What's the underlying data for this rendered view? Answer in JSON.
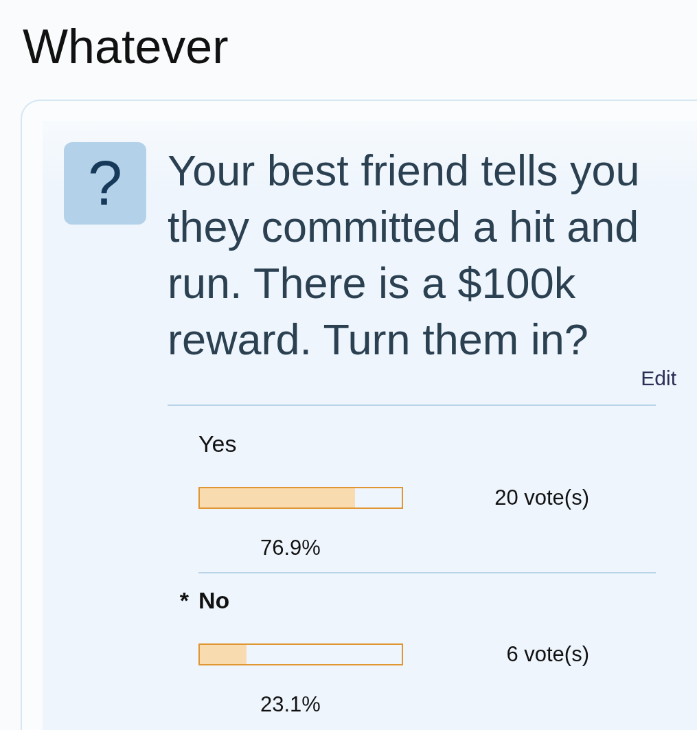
{
  "page": {
    "title": "Whatever"
  },
  "poll": {
    "icon_glyph": "?",
    "question": "Your best friend tells you they committed a hit and run. There is a $100k reward. Turn them in?",
    "edit_link": "Edit",
    "selected_marker": "*",
    "options": [
      {
        "label": "Yes",
        "selected": false,
        "level": 0.769,
        "votes": "20 vote(s)",
        "percent": "76.9%"
      },
      {
        "label": "No",
        "selected": true,
        "level": 0.231,
        "votes": "6 vote(s)",
        "percent": "23.1%"
      }
    ]
  }
}
